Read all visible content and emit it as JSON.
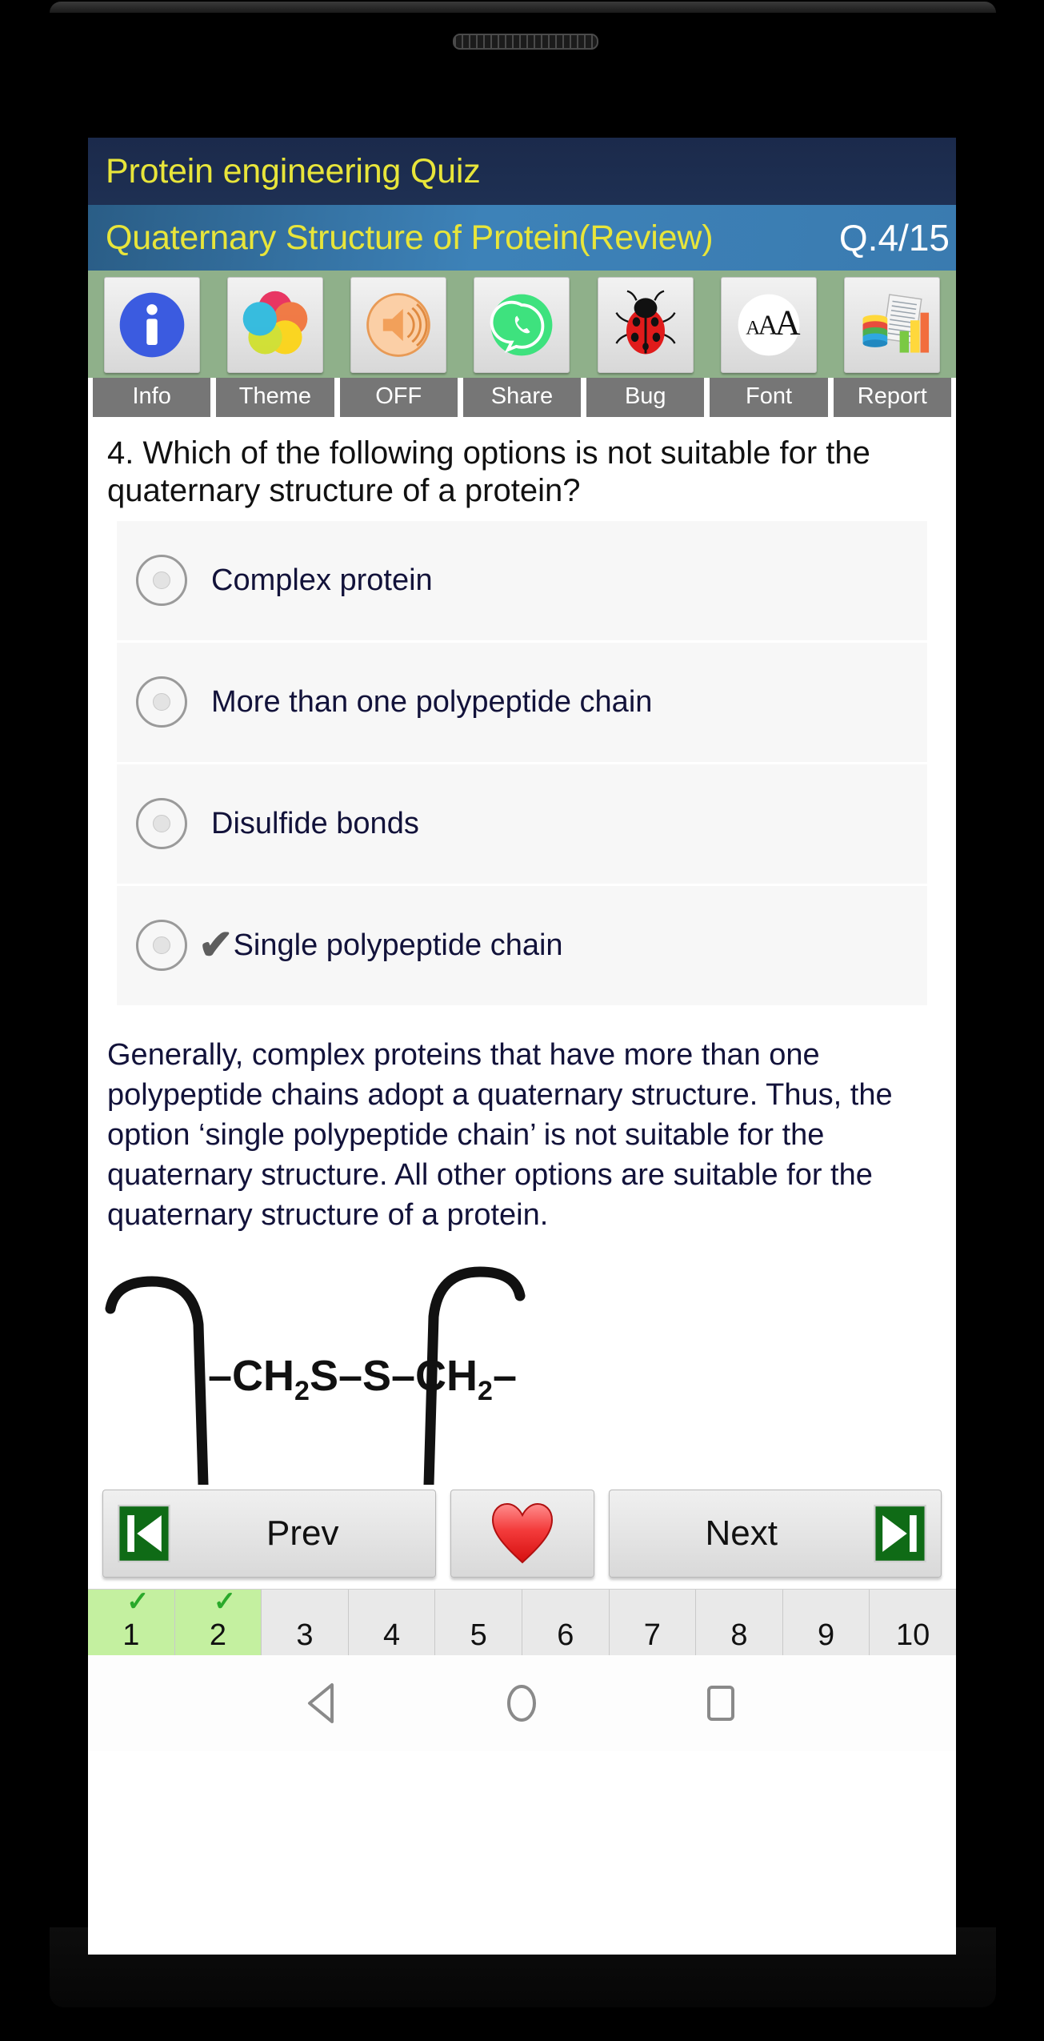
{
  "app": {
    "title": "Protein engineering Quiz",
    "subtitle": "Quaternary Structure of Protein(Review)",
    "question_counter": "Q.4/15"
  },
  "toolbar": {
    "items": [
      {
        "label": "Info",
        "icon": "info-icon"
      },
      {
        "label": "Theme",
        "icon": "color-wheel-icon"
      },
      {
        "label": "OFF",
        "icon": "speaker-icon"
      },
      {
        "label": "Share",
        "icon": "whatsapp-icon"
      },
      {
        "label": "Bug",
        "icon": "ladybug-icon"
      },
      {
        "label": "Font",
        "icon": "font-size-icon"
      },
      {
        "label": "Report",
        "icon": "report-chart-icon"
      }
    ]
  },
  "question": {
    "number": "4.",
    "text": "4. Which of the following options is not suitable for the quaternary structure of a protein?",
    "options": [
      {
        "label": "Complex protein",
        "selected": false,
        "correct_mark": false
      },
      {
        "label": "More than one polypeptide chain",
        "selected": false,
        "correct_mark": false
      },
      {
        "label": "Disulfide bonds",
        "selected": false,
        "correct_mark": false
      },
      {
        "label": "Single polypeptide chain",
        "selected": false,
        "correct_mark": true
      }
    ],
    "check_glyph": "✔"
  },
  "explanation": {
    "text": "Generally, complex proteins that have more than one polypeptide chains adopt a quaternary structure. Thus, the option ‘single polypeptide chain’ is not suitable for the quaternary structure. All other options are suitable for the quaternary structure of a protein."
  },
  "diagram": {
    "name": "disulfide-bridge-diagram",
    "formula_parts": [
      "–CH",
      "2",
      "S–S–CH",
      "2",
      "–"
    ],
    "formula_plain": "-CH2-S-S-CH2-"
  },
  "nav": {
    "prev_label": "Prev",
    "next_label": "Next",
    "favorite_icon": "heart-icon",
    "prev_icon": "skip-back-icon",
    "next_icon": "skip-forward-icon"
  },
  "pagination": {
    "pages": [
      {
        "num": "1",
        "done": true
      },
      {
        "num": "2",
        "done": true
      },
      {
        "num": "3",
        "done": false
      },
      {
        "num": "4",
        "done": false
      },
      {
        "num": "5",
        "done": false
      },
      {
        "num": "6",
        "done": false
      },
      {
        "num": "7",
        "done": false
      },
      {
        "num": "8",
        "done": false
      },
      {
        "num": "9",
        "done": false
      },
      {
        "num": "10",
        "done": false
      }
    ],
    "tick_glyph": "✓"
  },
  "system_nav": {
    "back": "back-icon",
    "home": "home-icon",
    "recents": "recents-icon"
  },
  "colors": {
    "header_top": "#1b2a4b",
    "header_bottom": "#3a7bb0",
    "title_text": "#e8e53a",
    "toolbar_bg": "#8fb08a",
    "label_bg": "#767676",
    "page_done": "#c4f0a0",
    "accent_green": "#17731a",
    "heart_red": "#ee2b2b"
  }
}
